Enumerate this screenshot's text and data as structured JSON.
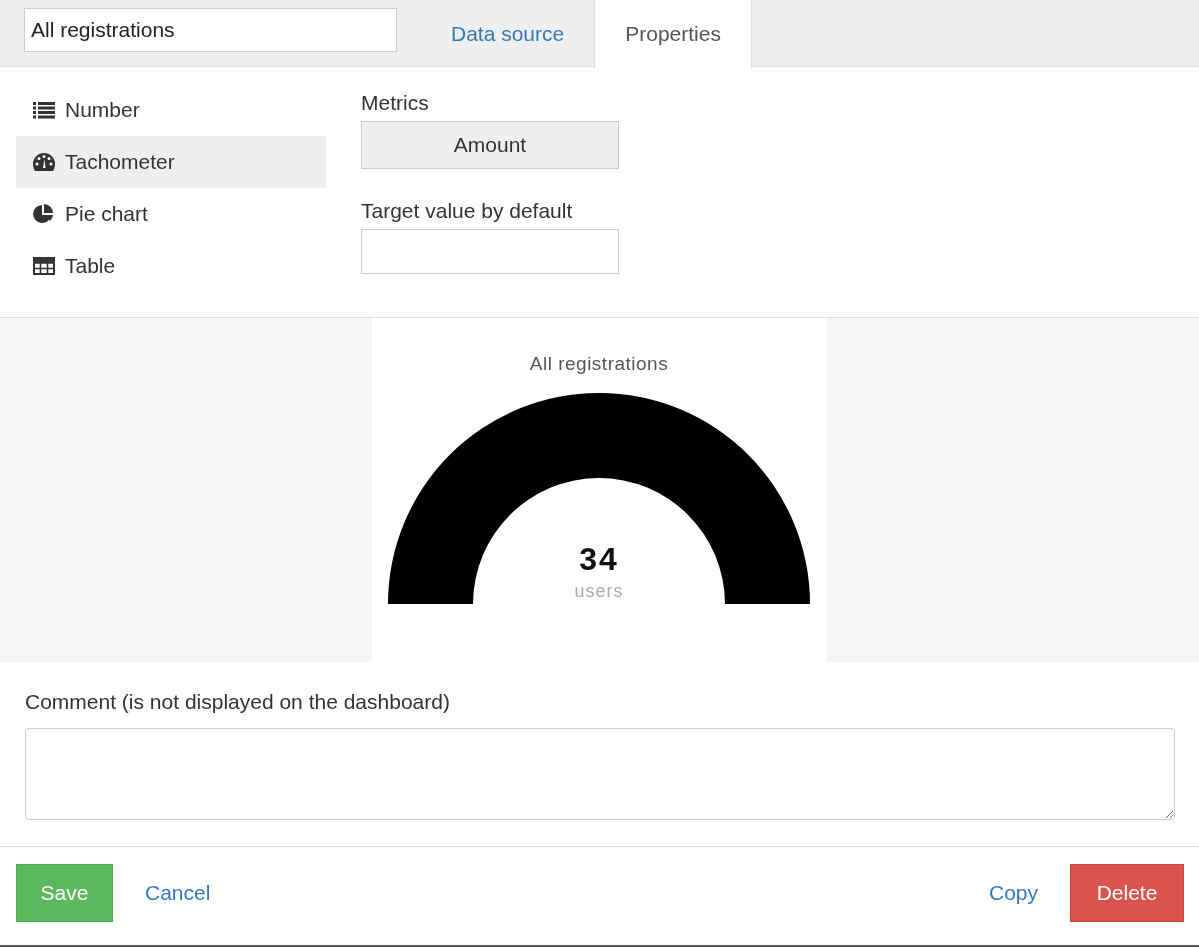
{
  "name_field": {
    "value": "All registrations"
  },
  "tabs": [
    {
      "label": "Data source",
      "selected": false
    },
    {
      "label": "Properties",
      "selected": true
    }
  ],
  "widget_types": [
    {
      "kind": "number",
      "label": "Number",
      "selected": false
    },
    {
      "kind": "tachometer",
      "label": "Tachometer",
      "selected": true
    },
    {
      "kind": "pie",
      "label": "Pie chart",
      "selected": false
    },
    {
      "kind": "table",
      "label": "Table",
      "selected": false
    }
  ],
  "metrics": {
    "label": "Metrics",
    "button": "Amount"
  },
  "target": {
    "label": "Target value by default"
  },
  "preview": {
    "title": "All registrations",
    "value": "34",
    "unit": "users",
    "level": 1
  },
  "comment": {
    "label": "Comment (is not displayed on the dashboard)"
  },
  "footer": {
    "save": "Save",
    "cancel": "Cancel",
    "copy": "Copy",
    "delete": "Delete"
  }
}
